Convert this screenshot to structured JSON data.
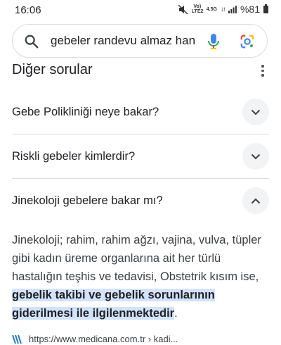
{
  "status_bar": {
    "time": "16:06",
    "vol_lte": "Vo) LTE2",
    "network": "4.5G",
    "battery": "%81"
  },
  "search": {
    "query": "gebeler randevu almaz han"
  },
  "section": {
    "title": "Diğer sorular"
  },
  "questions": [
    {
      "label": "Gebe Polikliniği neye bakar?",
      "expanded": false
    },
    {
      "label": "Riskli gebeler kimlerdir?",
      "expanded": false
    },
    {
      "label": "Jinekoloji gebelere bakar mı?",
      "expanded": true
    }
  ],
  "answer": {
    "text_plain": "Jinekoloji; rahim, rahim ağzı, vajina, vulva, tüpler gibi kadın üreme organlarına ait her türlü hastalığın teşhis ve tedavisi, Obstetrik kısım ise, ",
    "text_highlight": "gebelik takibi ve gebelik sorunlarının giderilmesi ile ilgilenmektedir",
    "text_end": "."
  },
  "source": {
    "url": "https://www.medicana.com.tr › kadi..."
  },
  "colors": {
    "highlight": "#d2e3fc",
    "toggle_bg": "#f1f3f4",
    "divider": "#dadce0",
    "mic_blue": "#4285f4"
  }
}
